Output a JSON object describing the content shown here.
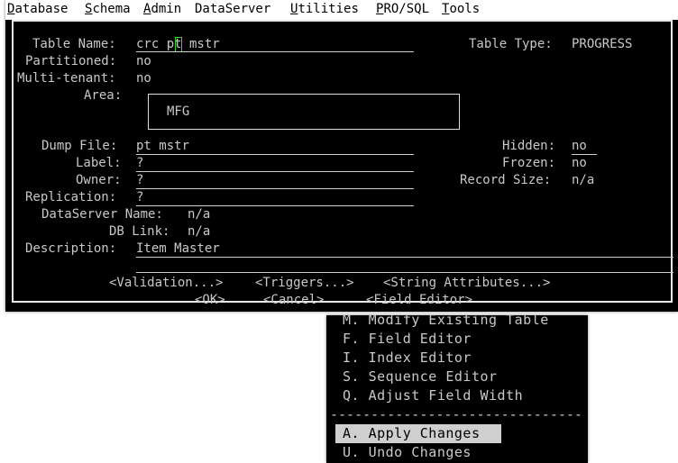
{
  "menubar": {
    "items": [
      {
        "hot": "D",
        "rest": "atabase"
      },
      {
        "hot": "S",
        "rest": "chema"
      },
      {
        "hot": "A",
        "rest": "dmin"
      },
      {
        "hot": "",
        "rest": "DataServer"
      },
      {
        "hot": "U",
        "rest": "tilities"
      },
      {
        "hot": "P",
        "rest": "RO/SQL"
      },
      {
        "hot": "T",
        "rest": "ools"
      }
    ]
  },
  "form": {
    "table_name_label": "Table Name:",
    "table_name_value_a": "crc ",
    "table_name_value_b": "pt mstr",
    "table_type_label": "Table Type:",
    "table_type_value": "PROGRESS",
    "partitioned_label": "Partitioned:",
    "partitioned_value": "no",
    "multitenant_label": "Multi-tenant:",
    "multitenant_value": "no",
    "area_label": "Area:",
    "area_value": "MFG",
    "dump_file_label": "Dump File:",
    "dump_file_value": "pt mstr",
    "hidden_label": "Hidden:",
    "hidden_value": "no",
    "label_label": "Label:",
    "label_value": "?",
    "frozen_label": "Frozen:",
    "frozen_value": "no",
    "owner_label": "Owner:",
    "owner_value": "?",
    "record_size_label": "Record Size:",
    "record_size_value": "n/a",
    "replication_label": "Replication:",
    "replication_value": "?",
    "dataserver_name_label": "DataServer Name:",
    "dataserver_name_value": "n/a",
    "db_link_label": "DB Link:",
    "db_link_value": "n/a",
    "description_label": "Description:",
    "description_value": "Item Master"
  },
  "buttons": {
    "validation": "<Validation...>",
    "triggers": "<Triggers...>",
    "string_attributes": "<String Attributes...>",
    "ok": "<OK>",
    "cancel": "<Cancel>",
    "field_editor": "<Field Editor>"
  },
  "popup": {
    "items": [
      "M. Modify Existing Table",
      "F. Field Editor",
      "I. Index Editor",
      "S. Sequence Editor",
      "Q. Adjust Field Width"
    ],
    "separator": "-------------------------------",
    "items2": [
      "A. Apply Changes",
      "U. Undo Changes"
    ]
  }
}
